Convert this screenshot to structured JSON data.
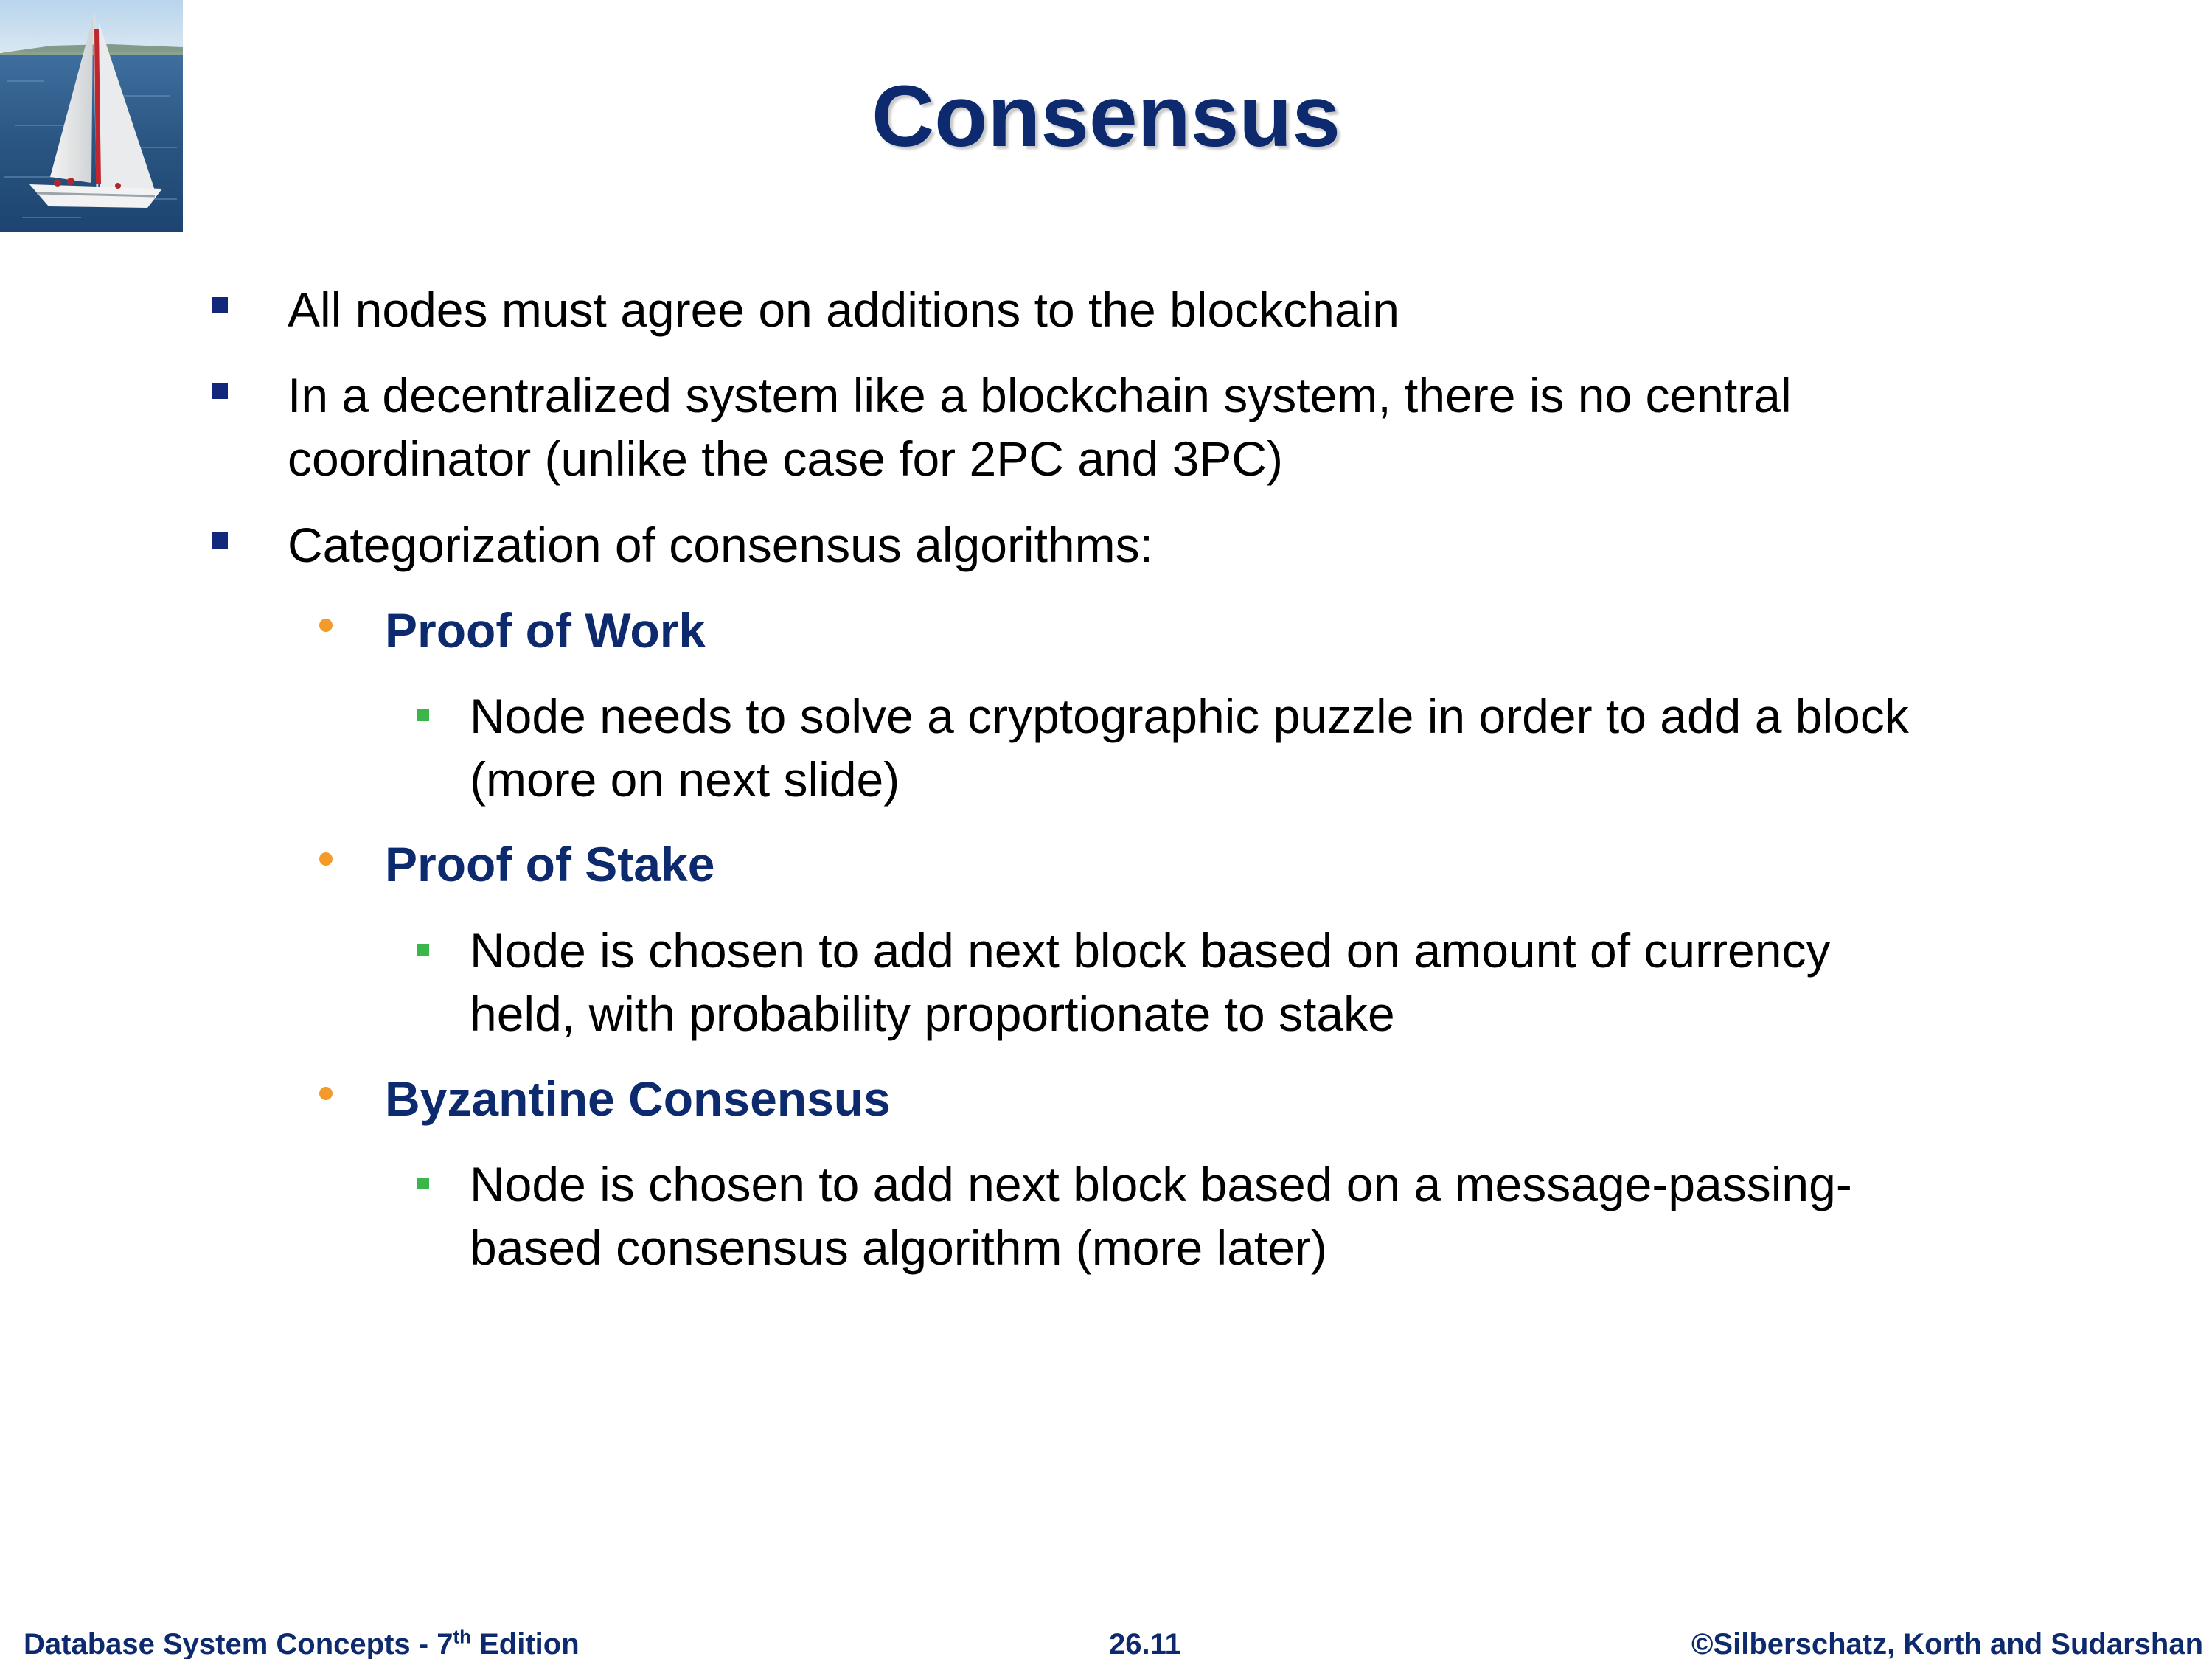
{
  "slide": {
    "title": "Consensus",
    "logo_icon": "sailboat-icon",
    "colors": {
      "title": "#0d2a6e",
      "level1_bullet": "#13287a",
      "level2_bullet": "#f39a2b",
      "level2_text": "#0d2a6e",
      "level3_bullet": "#3bb64a"
    }
  },
  "bullets": [
    {
      "text": "All nodes must agree on additions to the blockchain"
    },
    {
      "line1": "In a decentralized system like a blockchain system, there is no central",
      "line2": "coordinator (unlike the case for 2PC and 3PC)"
    },
    {
      "text": "Categorization of consensus algorithms:"
    }
  ],
  "algorithms": [
    {
      "name": "Proof of Work",
      "detail_line1": "Node needs to solve a cryptographic puzzle in order to add a block",
      "detail_line2": "(more on next slide)"
    },
    {
      "name": "Proof of Stake",
      "detail_line1": "Node is chosen to add next block based on amount of currency",
      "detail_line2": "held, with probability proportionate to stake"
    },
    {
      "name": "Byzantine Consensus",
      "detail_line1": "Node is chosen to add next block based on a message-passing-",
      "detail_line2": "based consensus algorithm (more later)"
    }
  ],
  "footer": {
    "left_prefix": "Database System Concepts - 7",
    "left_sup": "th",
    "left_suffix": " Edition",
    "center": "26.11",
    "right": "©Silberschatz, Korth and Sudarshan"
  }
}
